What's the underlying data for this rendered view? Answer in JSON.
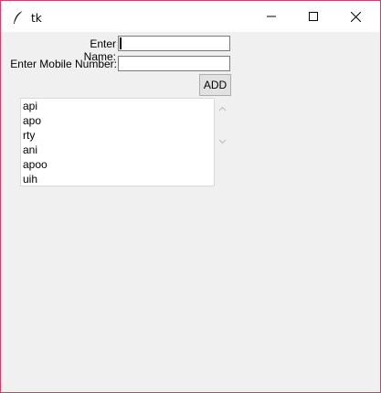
{
  "window": {
    "title": "tk",
    "icons": {
      "app": "feather-icon",
      "minimize": "minimize-icon",
      "maximize": "maximize-icon",
      "close": "close-icon"
    }
  },
  "form": {
    "name_label": "Enter Name:",
    "name_value": "",
    "mobile_label": "Enter Mobile Number:",
    "mobile_value": "",
    "add_button": "ADD"
  },
  "list": {
    "items": [
      "api",
      "apo",
      "rty",
      "ani",
      "apoo",
      "uih"
    ]
  },
  "scrollbar": {
    "up_icon": "chevron-up-icon",
    "down_icon": "chevron-down-icon"
  },
  "colors": {
    "window_border": "#c2456a",
    "background": "#f0f0f0",
    "titlebar": "#ffffff"
  }
}
